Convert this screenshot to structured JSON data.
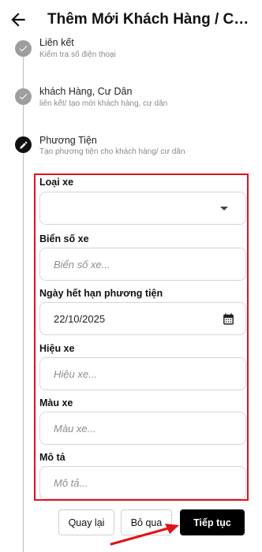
{
  "header": {
    "title": "Thêm Mới Khách Hàng / Cư Dân"
  },
  "steps": [
    {
      "title": "Liên kết",
      "subtitle": "Kiểm tra số điện thoại",
      "status": "done"
    },
    {
      "title": "khách Hàng, Cư Dân",
      "subtitle": "liên kết/ tạo mới khách hàng, cư dân",
      "status": "done"
    },
    {
      "title": "Phương Tiện",
      "subtitle": "Tạo phương tiện cho khách hàng/ cư dân",
      "status": "active"
    }
  ],
  "form": {
    "vehicle_type": {
      "label": "Loại xe",
      "value": ""
    },
    "plate": {
      "label": "Biển số xe",
      "placeholder": "Biển số xe..."
    },
    "expiry": {
      "label": "Ngày hết hạn phương tiện",
      "value": "22/10/2025"
    },
    "brand": {
      "label": "Hiệu xe",
      "placeholder": "Hiệu xe..."
    },
    "color": {
      "label": "Màu xe",
      "placeholder": "Màu xe..."
    },
    "description": {
      "label": "Mô tả",
      "placeholder": "Mô tả..."
    }
  },
  "actions": {
    "back": "Quay lại",
    "skip": "Bỏ qua",
    "next": "Tiếp tục"
  },
  "colors": {
    "highlight": "#e0121b",
    "primary": "#000000"
  }
}
